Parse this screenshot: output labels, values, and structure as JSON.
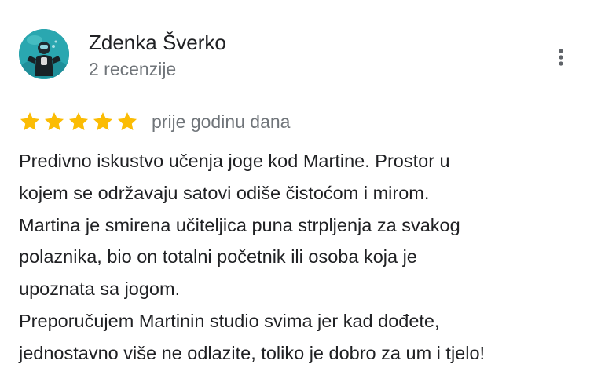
{
  "review": {
    "author": {
      "name": "Zdenka Šverko",
      "meta": "2 recenzije",
      "avatar_icon": "diver-avatar-icon"
    },
    "menu_icon": "more-vertical-icon",
    "rating": {
      "value": 5,
      "max": 5,
      "star_color": "#fbbc04"
    },
    "date": "prije godinu dana",
    "text_lines": [
      "Predivno iskustvo učenja joge kod Martine. Prostor u",
      "kojem se održavaju satovi odiše čistoćom i mirom.",
      "Martina je smirena učiteljica puna strpljenja za svakog",
      "polaznika, bio on totalni početnik ili osoba koja je",
      "upoznata sa jogom.",
      "Preporučujem Martinin studio svima jer kad dođete,",
      "jednostavno više ne odlazite, toliko je dobro za um i tjelo!"
    ]
  }
}
